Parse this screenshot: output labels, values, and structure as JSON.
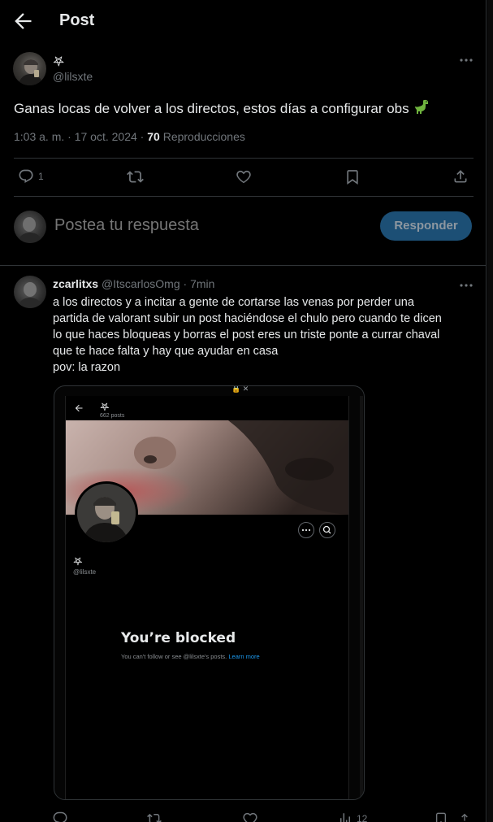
{
  "header": {
    "title": "Post"
  },
  "post": {
    "author_name": "𖤐",
    "author_handle": "@lilsxte",
    "text": "Ganas locas de volver a los directos, estos días a configurar obs",
    "time": "1:03 a. m.",
    "date": "17 oct. 2024",
    "views_count": "70",
    "views_label": "Reproducciones",
    "reply_count": "1"
  },
  "reply_box": {
    "placeholder": "Postea tu respuesta",
    "button_label": "Responder"
  },
  "comment": {
    "name": "zcarlitxs",
    "handle": "@ItscarlosOmg",
    "time": "7min",
    "text_line1": "a los directos y a incitar a gente de cortarse las venas por perder una",
    "text_line2": "partida de valorant subir un post haciéndose el chulo pero cuando te dicen",
    "text_line3": "lo que haces bloqueas y borras el post eres un triste ponte a currar chaval",
    "text_line4": "que te hace falta y hay que ayudar en casa",
    "text_line5": "pov: la razon",
    "views_count": "12",
    "screenshot": {
      "profile_name": "𖤐",
      "posts_count": "662 posts",
      "profile_handle": "@lilsxte",
      "blocked_title": "You’re blocked",
      "blocked_text": "You can't follow or see @lilsxte's posts.",
      "learn_more": "Learn more"
    }
  },
  "colors": {
    "background": "#000000",
    "text": "#e7e9ea",
    "muted": "#71767b",
    "border": "#2f3336",
    "accent": "#1d9bf0",
    "button_disabled_bg": "#1c4f75"
  },
  "icons": [
    "back-arrow-icon",
    "more-icon",
    "reply-icon",
    "repost-icon",
    "like-icon",
    "bookmark-icon",
    "share-icon",
    "dinosaur-emoji-icon",
    "search-icon",
    "views-icon"
  ]
}
